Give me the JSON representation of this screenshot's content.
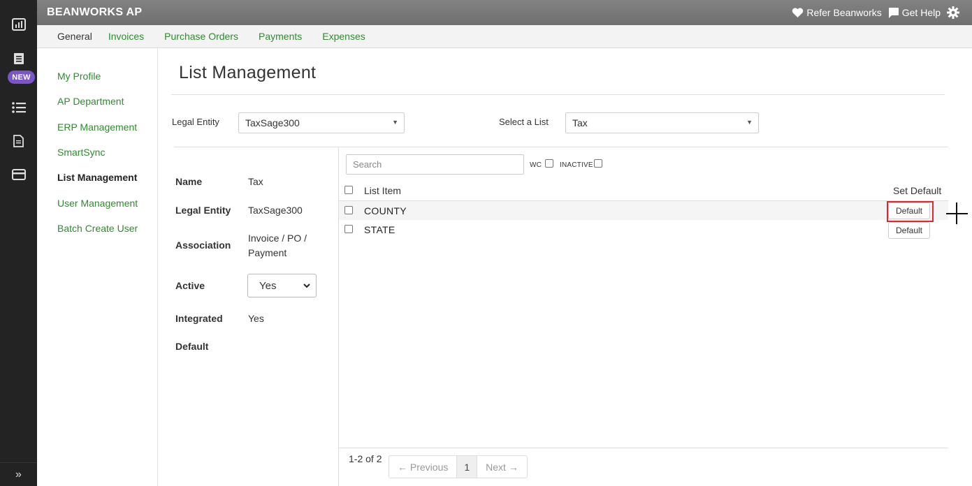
{
  "app": {
    "brand": "BEANWORKS AP",
    "refer_label": "Refer Beanworks",
    "help_label": "Get Help"
  },
  "rail": {
    "new_badge": "NEW",
    "icons": [
      "dashboard-icon",
      "document-list-icon",
      "list-icon",
      "file-icon",
      "card-icon"
    ],
    "expand_glyph": "»"
  },
  "tabs": [
    "General",
    "Invoices",
    "Purchase Orders",
    "Payments",
    "Expenses"
  ],
  "sidemenu": [
    "My Profile",
    "AP Department",
    "ERP Management",
    "SmartSync",
    "List Management",
    "User Management",
    "Batch Create User"
  ],
  "sidemenu_active": "List Management",
  "page": {
    "title": "List Management",
    "legal_entity_label": "Legal Entity",
    "legal_entity_value": "TaxSage300",
    "select_list_label": "Select a List",
    "select_list_value": "Tax"
  },
  "details": {
    "name_label": "Name",
    "name_value": "Tax",
    "entity_label": "Legal Entity",
    "entity_value": "TaxSage300",
    "association_label": "Association",
    "association_value_line1": "Invoice / PO /",
    "association_value_line2": "Payment",
    "active_label": "Active",
    "active_value": "Yes",
    "integrated_label": "Integrated",
    "integrated_value": "Yes",
    "default_label": "Default"
  },
  "list": {
    "search_placeholder": "Search",
    "wc_label": "WC",
    "inactive_label": "INACTIVE",
    "col_item": "List Item",
    "col_default": "Set Default",
    "rows": [
      {
        "item": "COUNTY",
        "action": "Default"
      },
      {
        "item": "STATE",
        "action": "Default"
      }
    ]
  },
  "pager": {
    "count": "1-2 of 2",
    "prev": "← Previous",
    "page": "1",
    "next": "Next →"
  },
  "colors": {
    "link_green": "#2e8b2e",
    "rail_bg": "#232323",
    "badge_purple": "#7b55c7",
    "highlight_red": "#e0282c"
  }
}
